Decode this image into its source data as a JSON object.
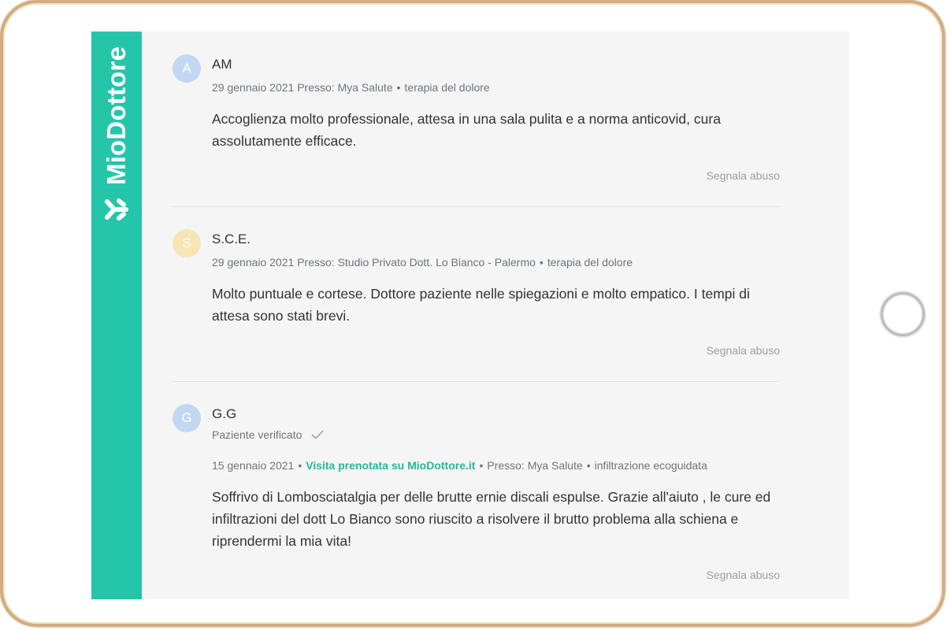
{
  "brand": {
    "name": "MioDottore",
    "color": "#25c5aa",
    "logo_icon": "miodottore-logo-icon"
  },
  "reviews": [
    {
      "initial": "A",
      "avatar_color": "#c3d7f2",
      "author": "AM",
      "date": "29 gennaio 2021",
      "location": "Presso: Mya Salute",
      "service": "terapia del dolore",
      "text": "Accoglienza molto professionale, attesa in una sala pulita e a norma anticovid, cura assolutamente efficace.",
      "report_label": "Segnala abuso"
    },
    {
      "initial": "S",
      "avatar_color": "#f6e6b4",
      "author": "S.C.E.",
      "date": "29 gennaio 2021",
      "location": "Presso: Studio Privato Dott. Lo Bianco - Palermo",
      "service": "terapia del dolore",
      "text": "Molto puntuale e cortese. Dottore paziente nelle spiegazioni e molto empatico. I tempi di attesa sono stati brevi.",
      "report_label": "Segnala abuso"
    },
    {
      "initial": "G",
      "avatar_color": "#c3d7f2",
      "author": "G.G",
      "verified_label": "Paziente verificato",
      "date": "15 gennaio 2021",
      "booking_label": "Visita prenotata su MioDottore.it",
      "location": "Presso: Mya Salute",
      "service": "infiltrazione ecoguidata",
      "text": "Soffrivo di Lombosciatalgia per delle brutte ernie discali espulse. Grazie all'aiuto , le cure ed infiltrazioni del dott Lo Bianco sono riuscito a risolvere il brutto problema alla schiena e riprendermi la mia vita!",
      "report_label": "Segnala abuso"
    }
  ]
}
